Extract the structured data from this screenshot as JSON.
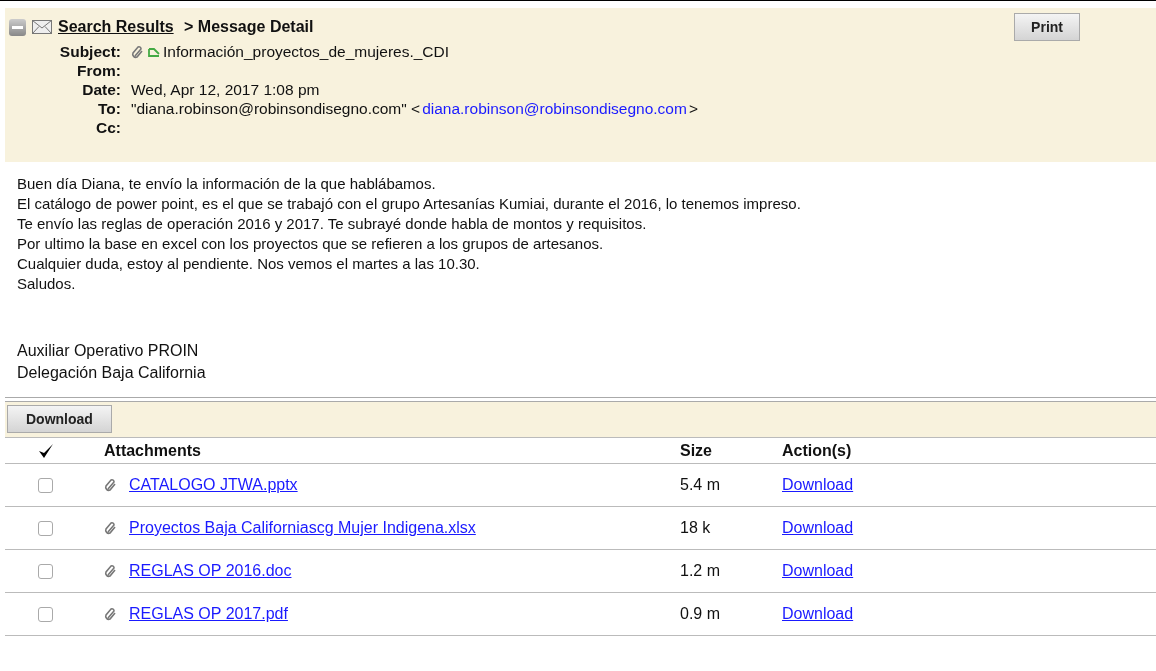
{
  "header": {
    "breadcrumb_link": "Search Results",
    "breadcrumb_rest": " > Message Detail",
    "print_button": "Print",
    "fields": [
      {
        "label": "Subject:",
        "value": "Información_proyectos_de_mujeres._CDI",
        "kind": "subject"
      },
      {
        "label": "From:",
        "kind": "plain"
      },
      {
        "label": "Date:",
        "value": "Wed, Apr 12, 2017 1:08 pm",
        "kind": "plain"
      },
      {
        "label": "To:",
        "value": "\"diana.robinson@robinsondisegno.com\" <",
        "link": "diana.robinson@robinsondisegno.com",
        "suffix": ">",
        "kind": "email"
      },
      {
        "label": "Cc:",
        "kind": "plain"
      }
    ]
  },
  "body": {
    "lines": [
      "Buen día Diana, te envío la información de la que hablábamos.",
      "El catálogo de power point, es el que se trabajó con el grupo Artesanías Kumiai, durante el 2016, lo tenemos impreso.",
      "Te envío las reglas de operación 2016 y 2017. Te subrayé donde habla de montos y requisitos.",
      "Por ultimo la base en excel con los proyectos que se refieren a los grupos de artesanos.",
      "Cualquier duda, estoy al pendiente. Nos vemos el martes a las 10.30.",
      "Saludos."
    ],
    "signature": [
      "Auxiliar Operativo PROIN",
      "Delegación Baja California"
    ]
  },
  "attachments": {
    "download_button": "Download",
    "columns": [
      "Attachments",
      "Size",
      "Action(s)"
    ],
    "rows": [
      {
        "checked": false,
        "name": "CATALOGO JTWA.pptx",
        "size": "5.4 m",
        "action": "Download"
      },
      {
        "checked": false,
        "name": "Proyectos Baja Californiascg Mujer Indigena.xlsx",
        "size": "18 k",
        "action": "Download"
      },
      {
        "checked": false,
        "name": "REGLAS OP 2016.doc",
        "size": "1.2 m",
        "action": "Download"
      },
      {
        "checked": false,
        "name": "REGLAS OP 2017.pdf",
        "size": "0.9 m",
        "action": "Download"
      }
    ]
  }
}
